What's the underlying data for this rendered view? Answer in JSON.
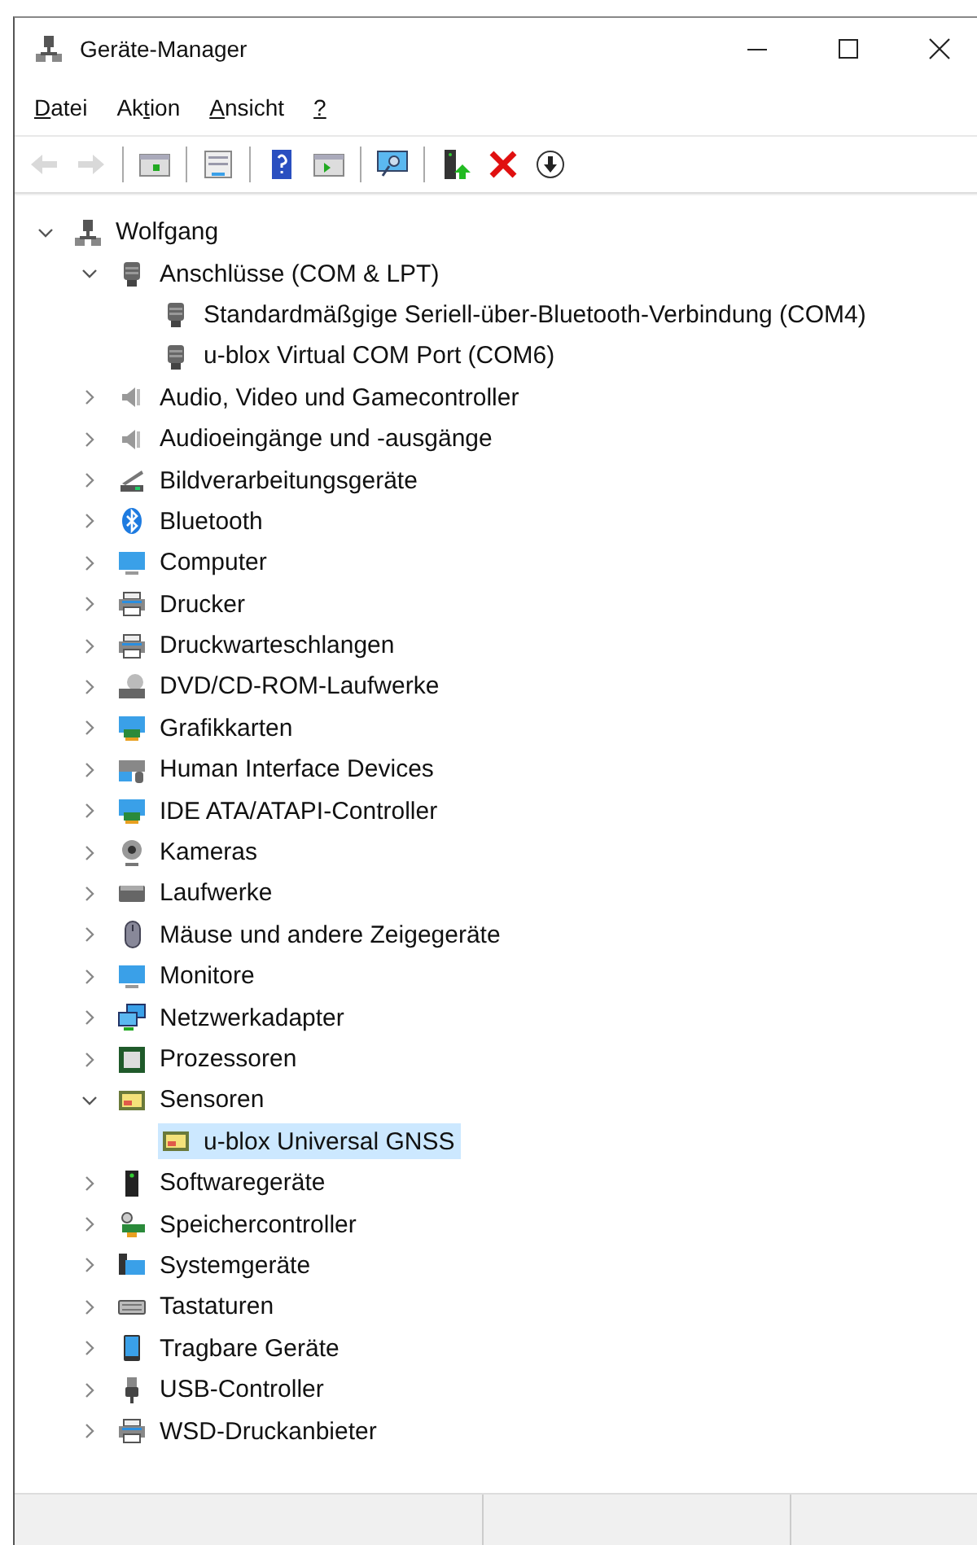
{
  "window": {
    "title": "Geräte-Manager"
  },
  "menu": [
    {
      "key": "D",
      "after": "atei"
    },
    {
      "before": "Ak",
      "key": "t",
      "after": "ion"
    },
    {
      "key": "A",
      "after": "nsicht"
    },
    {
      "key": "?"
    }
  ],
  "toolbar": [
    {
      "kind": "back",
      "disabled": true
    },
    {
      "kind": "forward",
      "disabled": true
    },
    {
      "kind": "sep"
    },
    {
      "kind": "tree",
      "disabled": false
    },
    {
      "kind": "sep"
    },
    {
      "kind": "properties",
      "disabled": false
    },
    {
      "kind": "sep"
    },
    {
      "kind": "help",
      "disabled": false
    },
    {
      "kind": "pane",
      "disabled": false
    },
    {
      "kind": "sep"
    },
    {
      "kind": "scan",
      "disabled": false
    },
    {
      "kind": "sep"
    },
    {
      "kind": "update",
      "disabled": false
    },
    {
      "kind": "remove",
      "disabled": false
    },
    {
      "kind": "disable",
      "disabled": false
    }
  ],
  "tree": [
    {
      "label": "Wolfgang",
      "kind": "computer",
      "expanded": true,
      "selected": false,
      "children": [
        {
          "label": "Anschlüsse (COM & LPT)",
          "kind": "port",
          "expanded": true,
          "selected": false,
          "children": [
            {
              "label": "Standardmäßgige Seriell-über-Bluetooth-Verbindung (COM4)",
              "kind": "port",
              "selected": false
            },
            {
              "label": "u-blox Virtual COM Port (COM6)",
              "kind": "port",
              "selected": false
            }
          ]
        },
        {
          "label": "Audio, Video und Gamecontroller",
          "kind": "speaker",
          "expanded": false,
          "selected": false
        },
        {
          "label": "Audioeingänge und -ausgänge",
          "kind": "speaker",
          "expanded": false,
          "selected": false
        },
        {
          "label": "Bildverarbeitungsgeräte",
          "kind": "scanner",
          "expanded": false,
          "selected": false
        },
        {
          "label": "Bluetooth",
          "kind": "bluetooth",
          "expanded": false,
          "selected": false
        },
        {
          "label": "Computer",
          "kind": "monitor",
          "expanded": false,
          "selected": false
        },
        {
          "label": "Drucker",
          "kind": "printer",
          "expanded": false,
          "selected": false
        },
        {
          "label": "Druckwarteschlangen",
          "kind": "printer",
          "expanded": false,
          "selected": false
        },
        {
          "label": "DVD/CD-ROM-Laufwerke",
          "kind": "disc",
          "expanded": false,
          "selected": false
        },
        {
          "label": "Grafikkarten",
          "kind": "card",
          "expanded": false,
          "selected": false
        },
        {
          "label": "Human Interface Devices",
          "kind": "hid",
          "expanded": false,
          "selected": false
        },
        {
          "label": "IDE ATA/ATAPI-Controller",
          "kind": "card",
          "expanded": false,
          "selected": false
        },
        {
          "label": "Kameras",
          "kind": "camera",
          "expanded": false,
          "selected": false
        },
        {
          "label": "Laufwerke",
          "kind": "drive",
          "expanded": false,
          "selected": false
        },
        {
          "label": "Mäuse und andere Zeigegeräte",
          "kind": "mouse",
          "expanded": false,
          "selected": false
        },
        {
          "label": "Monitore",
          "kind": "monitor",
          "expanded": false,
          "selected": false
        },
        {
          "label": "Netzwerkadapter",
          "kind": "network",
          "expanded": false,
          "selected": false
        },
        {
          "label": "Prozessoren",
          "kind": "chip",
          "expanded": false,
          "selected": false
        },
        {
          "label": "Sensoren",
          "kind": "sensor",
          "expanded": true,
          "selected": false,
          "children": [
            {
              "label": "u-blox Universal GNSS",
              "kind": "sensor",
              "selected": true
            }
          ]
        },
        {
          "label": "Softwaregeräte",
          "kind": "software",
          "expanded": false,
          "selected": false
        },
        {
          "label": "Speichercontroller",
          "kind": "storage",
          "expanded": false,
          "selected": false
        },
        {
          "label": "Systemgeräte",
          "kind": "system",
          "expanded": false,
          "selected": false
        },
        {
          "label": "Tastaturen",
          "kind": "keyboard",
          "expanded": false,
          "selected": false
        },
        {
          "label": "Tragbare Geräte",
          "kind": "tablet",
          "expanded": false,
          "selected": false
        },
        {
          "label": "USB-Controller",
          "kind": "usb",
          "expanded": false,
          "selected": false
        },
        {
          "label": "WSD-Druckanbieter",
          "kind": "printer",
          "expanded": false,
          "selected": false
        }
      ]
    }
  ]
}
